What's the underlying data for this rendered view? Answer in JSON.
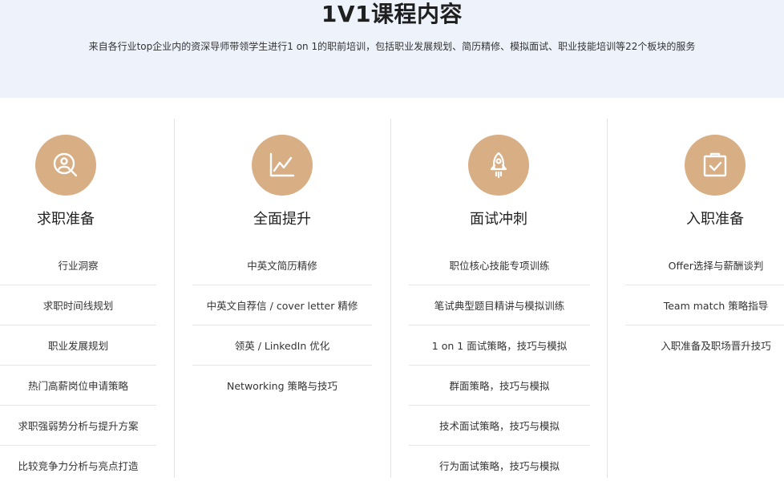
{
  "hero": {
    "title": "1V1课程内容",
    "subtitle": "来自各行业top企业内的资深导师带领学生进行1 on 1的职前培训，包括职业发展规划、简历精修、模拟面试、职业技能培训等22个板块的服务",
    "background": "#edf2fb"
  },
  "accent_color": "#d8ae85",
  "columns": [
    {
      "icon": "search-person-icon",
      "title": "求职准备",
      "items": [
        "行业洞察",
        "求职时间线规划",
        "职业发展规划",
        "热门高薪岗位申请策略",
        "求职强弱势分析与提升方案",
        "比较竞争力分析与亮点打造"
      ]
    },
    {
      "icon": "line-chart-icon",
      "title": "全面提升",
      "items": [
        "中英文简历精修",
        "中英文自荐信 / cover letter 精修",
        "领英 / LinkedIn 优化",
        "Networking 策略与技巧"
      ]
    },
    {
      "icon": "rocket-icon",
      "title": "面试冲刺",
      "items": [
        "职位核心技能专项训练",
        "笔试典型题目精讲与模拟训练",
        "1 on 1 面试策略，技巧与模拟",
        "群面策略，技巧与模拟",
        "技术面试策略，技巧与模拟",
        "行为面试策略，技巧与模拟"
      ]
    },
    {
      "icon": "clipboard-check-icon",
      "title": "入职准备",
      "items": [
        "Offer选择与薪酬谈判",
        "Team match 策略指导",
        "入职准备及职场晋升技巧"
      ]
    }
  ]
}
